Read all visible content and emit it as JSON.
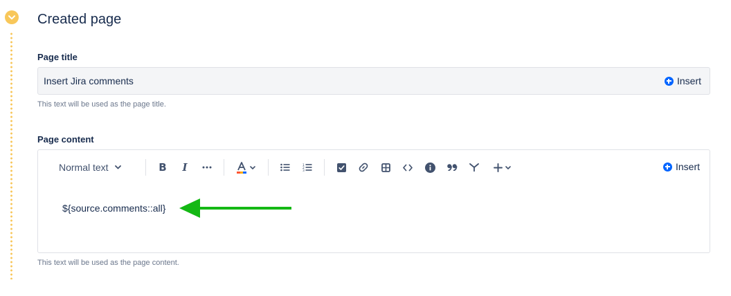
{
  "section": {
    "title": "Created page"
  },
  "page_title_field": {
    "label": "Page title",
    "value": "Insert Jira comments",
    "insert_label": "Insert",
    "help": "This text will be used as the page title."
  },
  "page_content_field": {
    "label": "Page content",
    "text_style": "Normal text",
    "insert_label": "Insert",
    "content": "${source.comments::all}",
    "help": "This text will be used as the page content."
  },
  "toolbar_icons": [
    "bold-icon",
    "italic-icon",
    "more-formatting-icon",
    "text-color-icon",
    "bullet-list-icon",
    "numbered-list-icon",
    "task-icon",
    "link-icon",
    "table-icon",
    "code-icon",
    "info-icon",
    "quote-icon",
    "expand-icon",
    "insert-more-icon"
  ],
  "colors": {
    "accent_blue": "#0065ff",
    "timeline_yellow": "#f8c75a",
    "annotation_arrow": "#14b814"
  }
}
